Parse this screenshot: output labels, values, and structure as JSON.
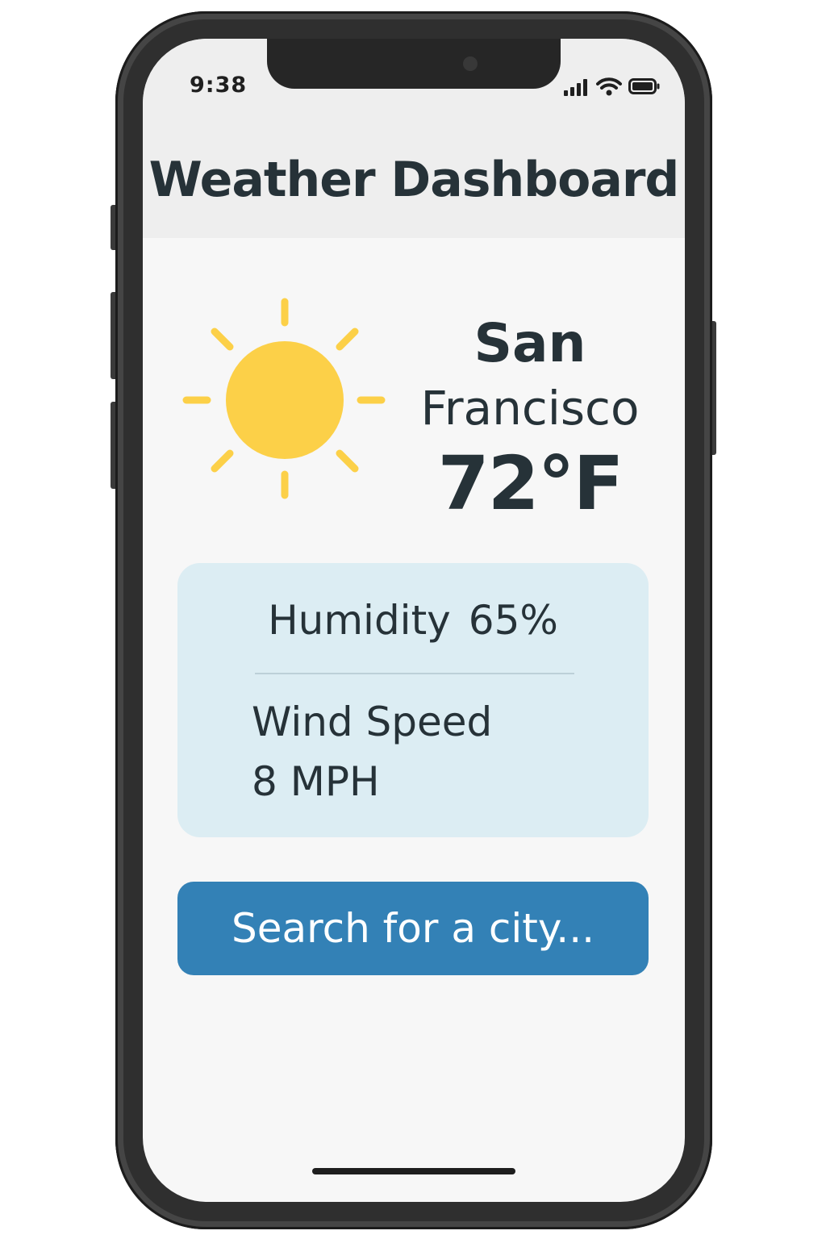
{
  "status_bar": {
    "time": "9:38",
    "icons": [
      "cellular-signal-icon",
      "wifi-icon",
      "battery-icon"
    ]
  },
  "header": {
    "title": "Weather Dashboard"
  },
  "current": {
    "icon": "sun-icon",
    "city_line1": "San",
    "city_line2": "Francisco",
    "temperature": "72°F"
  },
  "details": {
    "humidity_label": "Humidity",
    "humidity_value": "65%",
    "wind_label": "Wind Speed",
    "wind_value": "8 MPH"
  },
  "search": {
    "label": "Search for a city..."
  },
  "colors": {
    "sun": "#fcd048",
    "card_background": "#dcedf3",
    "button_background": "#3381b6",
    "text": "#263238",
    "header_background": "#eeeeee"
  }
}
